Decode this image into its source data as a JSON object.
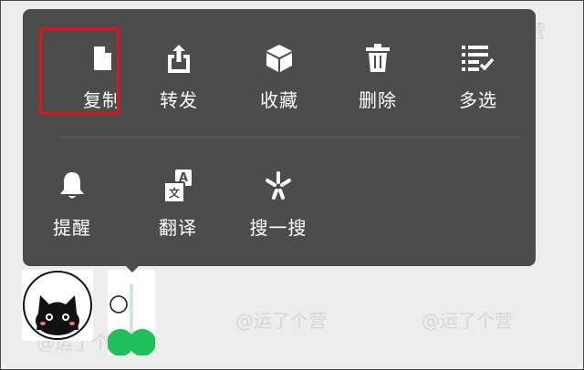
{
  "menu": {
    "row1": [
      {
        "label": "复制",
        "icon": "document-icon"
      },
      {
        "label": "转发",
        "icon": "share-icon"
      },
      {
        "label": "收藏",
        "icon": "cube-icon"
      },
      {
        "label": "删除",
        "icon": "trash-icon"
      },
      {
        "label": "多选",
        "icon": "checklist-icon"
      }
    ],
    "row2": [
      {
        "label": "提醒",
        "icon": "bell-icon"
      },
      {
        "label": "翻译",
        "icon": "translate-icon",
        "glyph_a": "A",
        "glyph_b": "文"
      },
      {
        "label": "搜一搜",
        "icon": "sparkle-icon"
      }
    ]
  },
  "highlight": {
    "target": "复制",
    "color": "#e0141a"
  },
  "watermark": "@运了个营",
  "colors": {
    "menu_bg": "#4c4c4c",
    "page_bg": "#ededed",
    "sticker_green": "#1fbf5a"
  }
}
